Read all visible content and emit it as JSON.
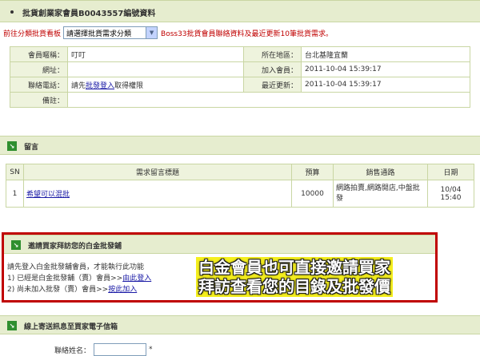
{
  "header": {
    "title": "批貨創業家會員B0043557編號資料"
  },
  "filter": {
    "label": "前往分類批貨看板",
    "selected": "請選擇批貨需求分類",
    "note": "Boss33批貨會員聯絡資料及最近更新10筆批貨需求。"
  },
  "info": {
    "name_label": "會員暱稱：",
    "name_value": "叮叮",
    "region_label": "所在地區：",
    "region_value": "台北基隆宜蘭",
    "url_label": "網址：",
    "url_value": "",
    "joined_label": "加入會員：",
    "joined_value": "2011-10-04 15:39:17",
    "phone_label": "聯絡電話：",
    "phone_prefix": "請先",
    "phone_link": "批發登入",
    "phone_suffix": "取得權限",
    "updated_label": "最近更新：",
    "updated_value": "2011-10-04 15:39:17",
    "note_label": "備註：",
    "note_value": ""
  },
  "messages": {
    "section_title": "留言",
    "headers": [
      "SN",
      "需求留言標題",
      "預算",
      "銷售通路",
      "日期"
    ],
    "rows": [
      {
        "sn": "1",
        "title": "希望可以混批",
        "budget": "10000",
        "channel": "網路拍賣,網路開店,中盤批發",
        "date": "10/04 15:40"
      }
    ]
  },
  "invite": {
    "section_title": "邀請買家拜訪您的白金批發鋪",
    "line1": "請先登入白金批發舖會員，才能執行此功能",
    "line2_prefix": "1) 已經是白金批發舖（賣）會員>>",
    "line2_link": "由此登入",
    "line3_prefix": "2) 尚未加入批發（賣）會員>>",
    "line3_link": "按此加入",
    "promo_line1": "白金會員也可直接邀請買家",
    "promo_line2": "拜訪查看您的目錄及批發價"
  },
  "mail": {
    "section_title": "線上寄送訊息至買家電子信箱",
    "name_label": "聯絡姓名：",
    "required_mark": "*"
  },
  "colors": {
    "accent_red": "#c00000",
    "section_green": "#e6edcf",
    "icon_green": "#2f8f2f"
  }
}
